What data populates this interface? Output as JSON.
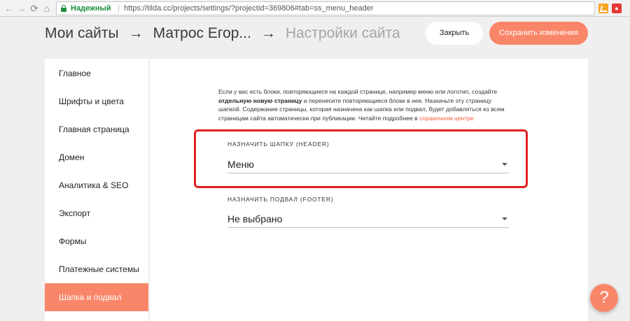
{
  "browser": {
    "secure_label": "Надежный",
    "url": "https://tilda.cc/projects/settings/?projectid=369806#tab=ss_menu_header",
    "icons": [
      "back-icon",
      "forward-icon",
      "reload-icon",
      "home-icon",
      "lock-icon",
      "star-icon",
      "extension-icon",
      "extension-icon"
    ],
    "ext2_label": "●"
  },
  "header": {
    "breadcrumb": {
      "item1": "Мои сайты",
      "sep1": "→",
      "item2": "Матрос Егор...",
      "sep2": "→",
      "current": "Настройки сайта"
    },
    "close_label": "Закрыть",
    "save_label": "Сохранить изменения"
  },
  "sidebar": {
    "items": [
      {
        "label": "Главное"
      },
      {
        "label": "Шрифты и цвета"
      },
      {
        "label": "Главная страница"
      },
      {
        "label": "Домен"
      },
      {
        "label": "Аналитика & SEO"
      },
      {
        "label": "Экспорт"
      },
      {
        "label": "Формы"
      },
      {
        "label": "Платежные системы"
      },
      {
        "label": "Шапка и подвал",
        "active": true
      }
    ]
  },
  "main": {
    "description": {
      "part1": "Если у вас есть блоки, повторяющиеся на каждой странице, например меню или логотип, создайте",
      "bold": "отдельную новую страницу",
      "part2": "и перенесите повторяющиеся блоки в нее. Назначьте эту страницу шапкой. Содержание страницы, которая назначена как шапка или подвал, будет добавляться ко всем страницам сайта автоматически при публикации. Читайте подробнее в",
      "link": "справочном центре"
    },
    "header_field": {
      "label": "НАЗНАЧИТЬ ШАПКУ (HEADER)",
      "value": "Меню"
    },
    "footer_field": {
      "label": "НАЗНАЧИТЬ ПОДВАЛ (FOOTER)",
      "value": "Не выбрано"
    }
  },
  "help": {
    "label": "?"
  },
  "colors": {
    "accent": "#fa8669",
    "highlight": "#e02020",
    "link": "#fa5d3d",
    "secure": "#1e8e3e"
  }
}
